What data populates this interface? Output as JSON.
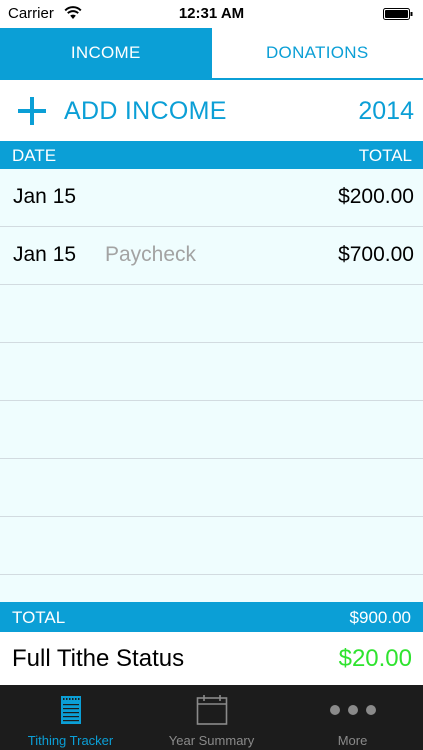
{
  "status_bar": {
    "carrier": "Carrier",
    "time": "12:31 AM"
  },
  "segments": [
    {
      "label": "INCOME",
      "active": true
    },
    {
      "label": "DONATIONS",
      "active": false
    }
  ],
  "add_row": {
    "label": "ADD INCOME",
    "year": "2014"
  },
  "table": {
    "columns": [
      "DATE",
      "TOTAL"
    ],
    "rows": [
      {
        "date": "Jan 15",
        "note": "",
        "amount": "$200.00"
      },
      {
        "date": "Jan 15",
        "note": "Paycheck",
        "amount": "$700.00"
      }
    ]
  },
  "total": {
    "label": "TOTAL",
    "value": "$900.00"
  },
  "tithe": {
    "label": "Full Tithe Status",
    "value": "$20.00"
  },
  "tab_bar": [
    {
      "label": "Tithing Tracker",
      "icon": "notepad-icon",
      "selected": true
    },
    {
      "label": "Year Summary",
      "icon": "calendar-icon",
      "selected": false
    },
    {
      "label": "More",
      "icon": "more-dots-icon",
      "selected": false
    }
  ],
  "colors": {
    "accent": "#0b9fd6",
    "row_background": "#effdfe",
    "positive": "#2fe32f",
    "tab_bar_background": "#1c1c1c"
  }
}
